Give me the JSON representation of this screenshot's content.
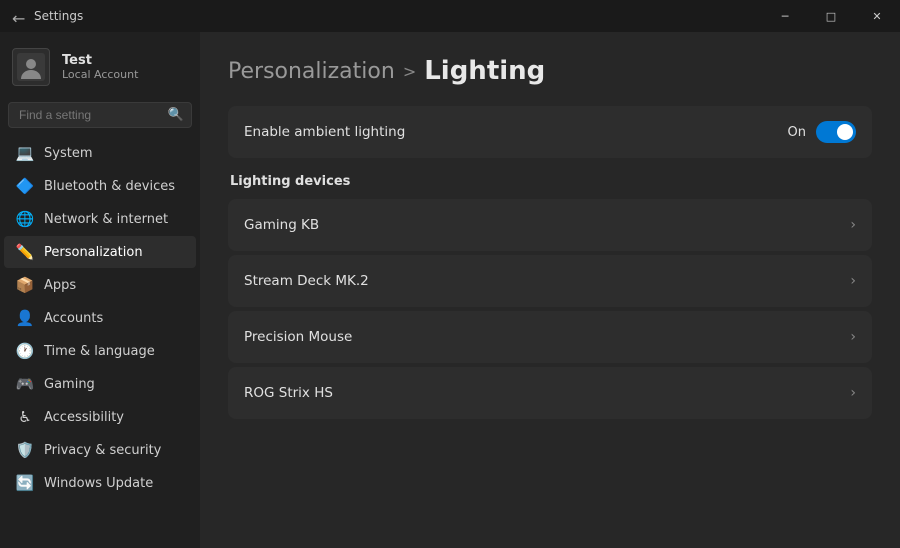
{
  "titlebar": {
    "title": "Settings",
    "back_icon": "←",
    "minimize_label": "─",
    "maximize_label": "□",
    "close_label": "✕"
  },
  "user": {
    "name": "Test",
    "account_type": "Local Account"
  },
  "search": {
    "placeholder": "Find a setting"
  },
  "nav": {
    "items": [
      {
        "id": "system",
        "label": "System",
        "icon": "💻"
      },
      {
        "id": "bluetooth",
        "label": "Bluetooth & devices",
        "icon": "🔷"
      },
      {
        "id": "network",
        "label": "Network & internet",
        "icon": "🌐"
      },
      {
        "id": "personalization",
        "label": "Personalization",
        "icon": "✏️",
        "active": true
      },
      {
        "id": "apps",
        "label": "Apps",
        "icon": "📦"
      },
      {
        "id": "accounts",
        "label": "Accounts",
        "icon": "👤"
      },
      {
        "id": "time",
        "label": "Time & language",
        "icon": "🕐"
      },
      {
        "id": "gaming",
        "label": "Gaming",
        "icon": "🎮"
      },
      {
        "id": "accessibility",
        "label": "Accessibility",
        "icon": "♿"
      },
      {
        "id": "privacy",
        "label": "Privacy & security",
        "icon": "🛡️"
      },
      {
        "id": "windows-update",
        "label": "Windows Update",
        "icon": "🔄"
      }
    ]
  },
  "content": {
    "breadcrumb_parent": "Personalization",
    "breadcrumb_separator": ">",
    "breadcrumb_current": "Lighting",
    "toggle": {
      "label": "Enable ambient lighting",
      "status": "On"
    },
    "devices_section_title": "Lighting devices",
    "devices": [
      {
        "name": "Gaming KB"
      },
      {
        "name": "Stream Deck MK.2"
      },
      {
        "name": "Precision Mouse"
      },
      {
        "name": "ROG Strix HS"
      }
    ]
  }
}
